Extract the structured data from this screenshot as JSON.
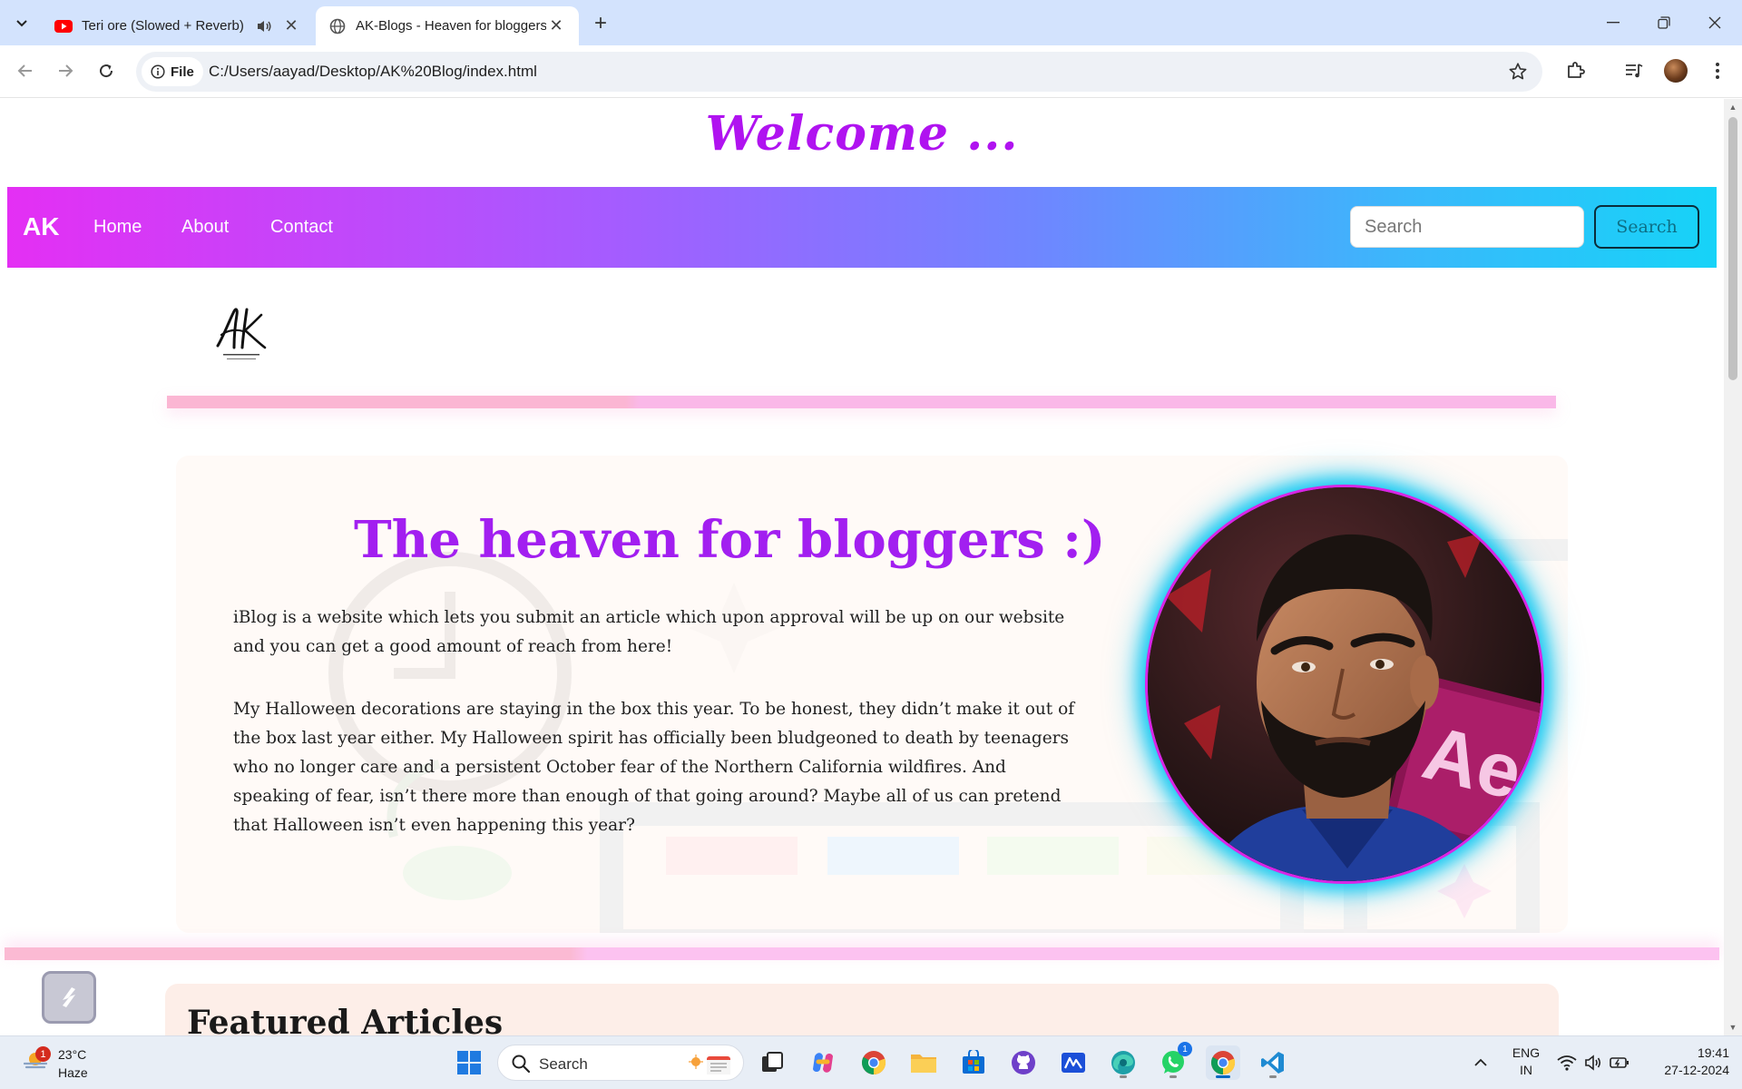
{
  "browser": {
    "tabs": [
      {
        "title": "Teri ore (Slowed + Reverb) |",
        "favicon": "youtube-icon",
        "audio": true
      },
      {
        "title": "AK-Blogs - Heaven for bloggers",
        "favicon": "globe-icon",
        "active": true
      }
    ],
    "address": {
      "chip_label": "File",
      "url": "C:/Users/aayad/Desktop/AK%20Blog/index.html"
    }
  },
  "page": {
    "welcome": "Welcome ...",
    "navbar": {
      "brand": "AK",
      "links": [
        "Home",
        "About",
        "Contact"
      ],
      "search_placeholder": "Search",
      "search_button": "Search"
    },
    "hero": {
      "title": "The heaven for bloggers :)",
      "paragraph1": "iBlog is a website which lets you submit an article which upon approval will be up on our website and you can get a good amount of reach from here!",
      "paragraph2": "My Halloween decorations are staying in the box this year. To be honest, they didn’t make it out of the box last year either. My Halloween spirit has officially been bludgeoned to death by teenagers who no longer care and a persistent October fear of the Northern California wildfires. And speaking of fear, isn’t there more than enough of that going around? Maybe all of us can pretend that Halloween isn’t even happening this year?",
      "portrait_badge": "Ae"
    },
    "featured": {
      "title": "Featured Articles"
    },
    "colors": {
      "accent": "#a21ff0",
      "welcome": "#b013f0",
      "navbar_gradient_start": "#e42ff4",
      "navbar_gradient_end": "#16d3f8",
      "portrait_ring": "#12c8f2"
    }
  },
  "taskbar": {
    "weather": {
      "temp": "23°C",
      "condition": "Haze",
      "badge": "1"
    },
    "search_label": "Search",
    "apps": [
      "windows-start-icon",
      "task-view-icon",
      "copilot-icon",
      "chrome-icon",
      "file-explorer-icon",
      "microsoft-store-icon",
      "github-desktop-icon",
      "editor-icon",
      "edge-dev-icon",
      "whatsapp-icon",
      "chrome-icon",
      "vscode-icon"
    ],
    "whatsapp_badge": "1",
    "language": {
      "line1": "ENG",
      "line2": "IN"
    },
    "clock": {
      "time": "19:41",
      "date": "27-12-2024"
    }
  }
}
